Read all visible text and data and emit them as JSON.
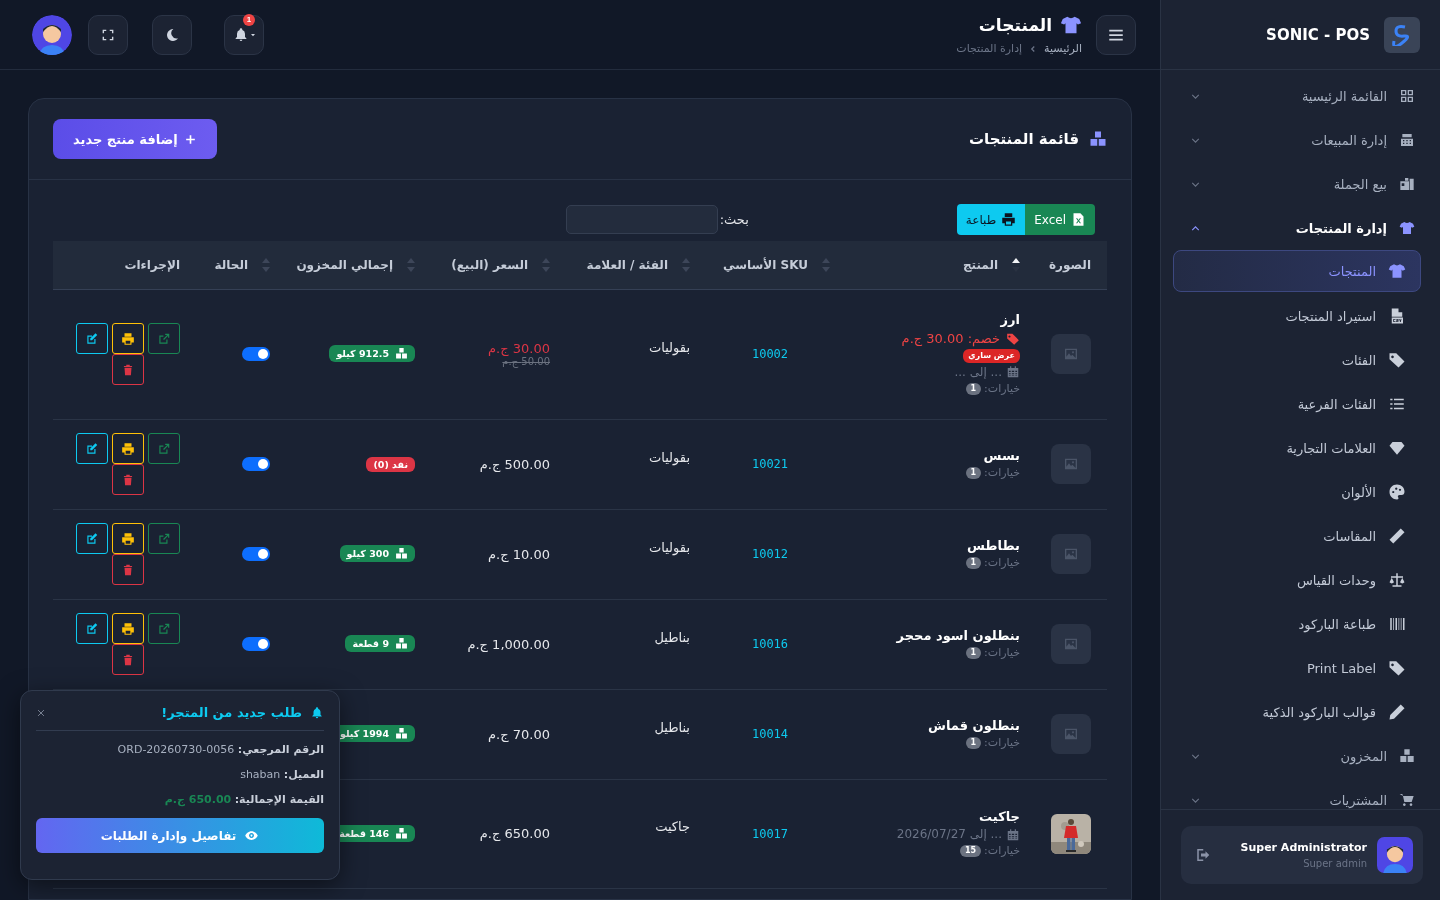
{
  "sidebar": {
    "brand": "SONIC - POS",
    "items": [
      {
        "label": "القائمة الرئيسية",
        "expanded": false
      },
      {
        "label": "إدارة المبيعات",
        "expanded": false
      },
      {
        "label": "بيع الجملة",
        "expanded": false
      },
      {
        "label": "إدارة المنتجات",
        "expanded": true,
        "children": [
          {
            "label": "المنتجات",
            "selected": true
          },
          {
            "label": "استيراد المنتجات",
            "selected": false
          },
          {
            "label": "الفئات",
            "selected": false
          },
          {
            "label": "الفئات الفرعية",
            "selected": false
          },
          {
            "label": "العلامات التجارية",
            "selected": false
          },
          {
            "label": "الألوان",
            "selected": false
          },
          {
            "label": "المقاسات",
            "selected": false
          },
          {
            "label": "وحدات القياس",
            "selected": false
          },
          {
            "label": "طباعة الباركود",
            "selected": false
          },
          {
            "label": "Print Label",
            "selected": false
          },
          {
            "label": "قوالب الباركود الذكية",
            "selected": false
          }
        ]
      },
      {
        "label": "المخزون",
        "expanded": false
      },
      {
        "label": "المشتريات",
        "expanded": false
      }
    ]
  },
  "user": {
    "name": "Super Administrator",
    "role": "Super admin"
  },
  "header": {
    "title": "المنتجات",
    "breadcrumb": [
      "الرئيسية",
      "إدارة المنتجات"
    ],
    "notifications": "1"
  },
  "card": {
    "title": "قائمة المنتجات",
    "add_button": "إضافة منتج جديد",
    "export_buttons": [
      {
        "label": "Excel",
        "kind": "excel"
      },
      {
        "label": "طباعة",
        "kind": "print"
      }
    ],
    "search": {
      "label": "بحث:"
    },
    "columns": [
      {
        "label": "الصورة",
        "sortable": false
      },
      {
        "label": "المنتج",
        "sortable": true,
        "sorted": true
      },
      {
        "label": "SKU الأساسي",
        "sortable": true,
        "sorted": false
      },
      {
        "label": "الفئة / العلامة",
        "sortable": true,
        "sorted": false
      },
      {
        "label": "السعر (البيع)",
        "sortable": true,
        "sorted": false
      },
      {
        "label": "إجمالي المخزون",
        "sortable": true,
        "sorted": false
      },
      {
        "label": "الحالة",
        "sortable": true,
        "sorted": false
      },
      {
        "label": "الإجراءات",
        "sortable": false
      }
    ],
    "rows": [
      {
        "image": {
          "kind": "placeholder"
        },
        "name": "ارز",
        "discount": "خصم: 30.00 ج.م",
        "offer_badge": "عرض ساري",
        "period": "... إلى ...",
        "options_label": "خيارات:",
        "options": "1",
        "sku": "10002",
        "category": "بقوليات",
        "price": "30.00 ج.م",
        "old_price": "50.00 ج.م",
        "stock": {
          "text": "912.5 كيلو",
          "kind": "in"
        },
        "active": true
      },
      {
        "image": {
          "kind": "placeholder"
        },
        "name": "بسس",
        "options_label": "خيارات:",
        "options": "1",
        "sku": "10021",
        "category": "بقوليات",
        "price": "500.00 ج.م",
        "stock": {
          "text": "نفد (0)",
          "kind": "out"
        },
        "active": true
      },
      {
        "image": {
          "kind": "placeholder"
        },
        "name": "بطاطس",
        "options_label": "خيارات:",
        "options": "1",
        "sku": "10012",
        "category": "بقوليات",
        "price": "10.00 ج.م",
        "stock": {
          "text": "300 كيلو",
          "kind": "in"
        },
        "active": true
      },
      {
        "image": {
          "kind": "placeholder"
        },
        "name": "بنطلون اسود محجر",
        "options_label": "خيارات:",
        "options": "1",
        "sku": "10016",
        "category": "بناطيل",
        "price": "1,000.00 ج.م",
        "stock": {
          "text": "9 قطعة",
          "kind": "in"
        },
        "active": true
      },
      {
        "image": {
          "kind": "placeholder"
        },
        "name": "بنطلون قماش",
        "options_label": "خيارات:",
        "options": "1",
        "sku": "10014",
        "category": "بناطيل",
        "price": "70.00 ج.م",
        "stock": {
          "text": "1994 كيلو",
          "kind": "in"
        }
      },
      {
        "name": "جاكيت",
        "period": "... إلى 2026/07/27",
        "options_label": "خيارات:",
        "options": "15",
        "sku": "10017",
        "category": "جاكيت",
        "price": "650.00 ج.م",
        "stock": {
          "text": "146 قطعة",
          "kind": "in"
        }
      }
    ]
  },
  "toast": {
    "title": "طلب جديد من المتجر!",
    "fields": [
      {
        "label": "الرقم المرجعي:",
        "value": "ORD-20260730-0056",
        "kind": "text"
      },
      {
        "label": "العميل:",
        "value": "shaban",
        "kind": "text"
      },
      {
        "label": "القيمة الإجمالية:",
        "value": "650.00 ج.م",
        "kind": "money"
      }
    ],
    "button": "تفاصيل وإدارة الطلبات"
  }
}
